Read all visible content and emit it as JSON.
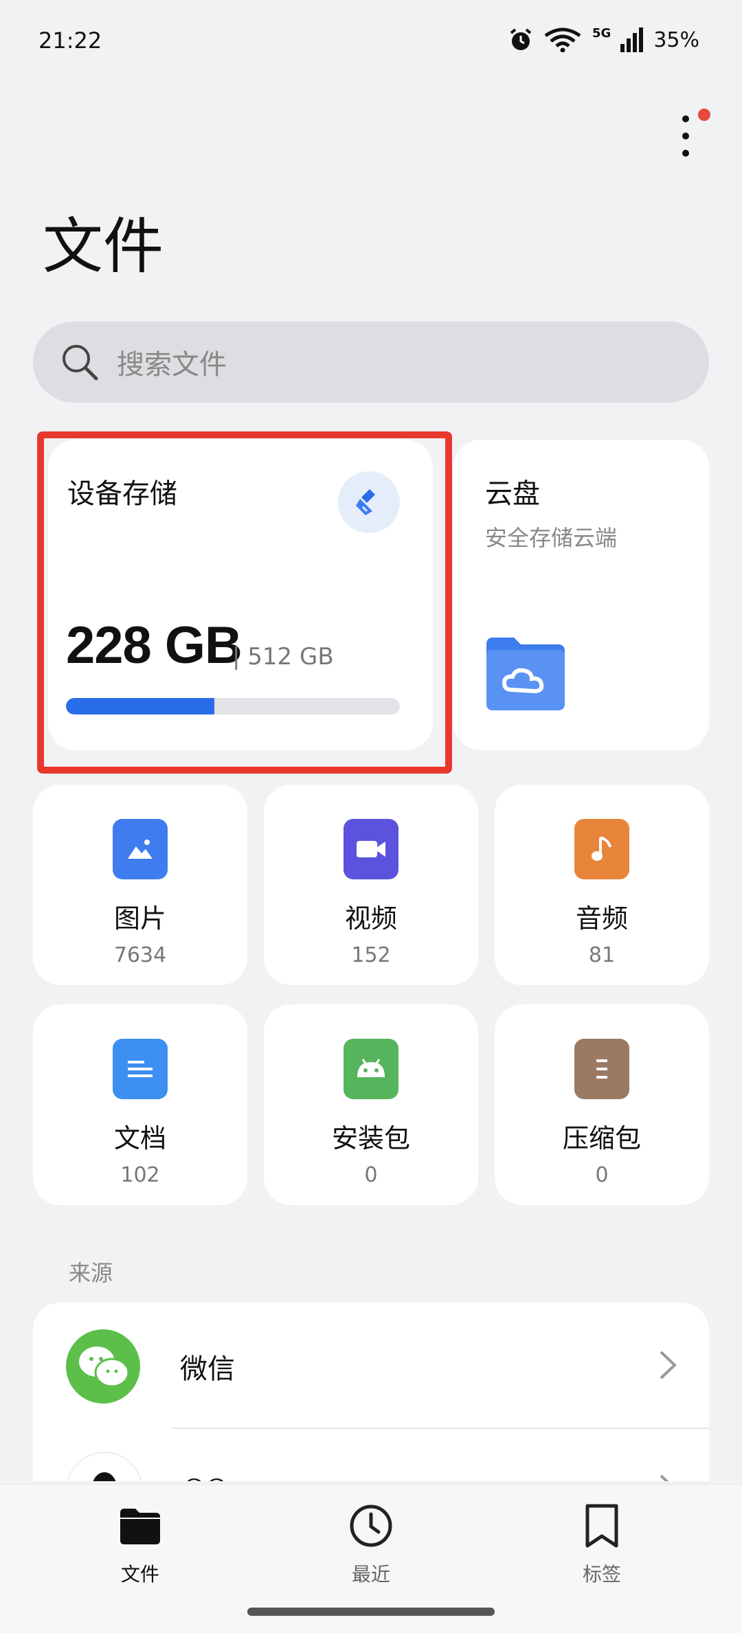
{
  "status_bar": {
    "time": "21:22",
    "network": "5G",
    "battery": "35%"
  },
  "header": {
    "title": "文件",
    "menu_icon": "more-vert-icon",
    "notification_dot_color": "#e5493f"
  },
  "search": {
    "placeholder": "搜索文件"
  },
  "device_storage": {
    "title": "设备存储",
    "used": "228 GB",
    "total": "| 512 GB",
    "used_fraction": 0.445,
    "bar_color": "#2a6de8",
    "clean_icon": "broom-icon"
  },
  "cloud": {
    "title": "云盘",
    "subtitle": "安全存储云端",
    "icon": "cloud-folder-icon"
  },
  "categories": [
    {
      "label": "图片",
      "count": "7634",
      "icon": "image-icon",
      "color": "#3f7cf0"
    },
    {
      "label": "视频",
      "count": "152",
      "icon": "video-icon",
      "color": "#5b53de"
    },
    {
      "label": "音频",
      "count": "81",
      "icon": "music-icon",
      "color": "#e8853a"
    },
    {
      "label": "文档",
      "count": "102",
      "icon": "document-icon",
      "color": "#3d8ff2"
    },
    {
      "label": "安装包",
      "count": "0",
      "icon": "android-icon",
      "color": "#56b45d"
    },
    {
      "label": "压缩包",
      "count": "0",
      "icon": "zip-icon",
      "color": "#9a7a62"
    }
  ],
  "sources": {
    "label": "来源",
    "items": [
      {
        "name": "微信",
        "icon": "wechat-icon"
      },
      {
        "name": "QQ",
        "icon": "qq-icon"
      }
    ]
  },
  "tabbar": {
    "tabs": [
      {
        "label": "文件",
        "icon": "folder-icon"
      },
      {
        "label": "最近",
        "icon": "clock-icon"
      },
      {
        "label": "标签",
        "icon": "bookmark-icon"
      }
    ]
  }
}
